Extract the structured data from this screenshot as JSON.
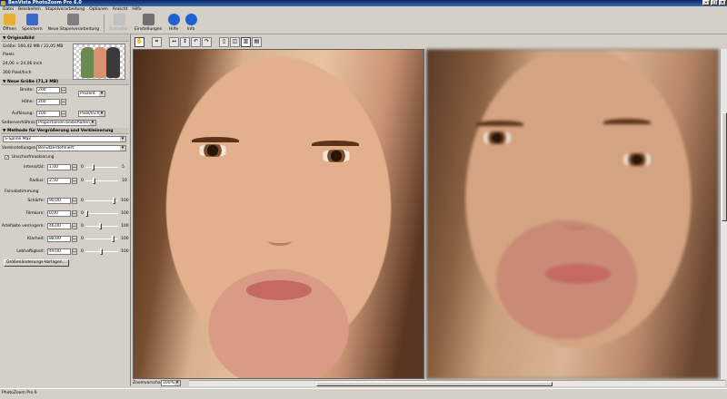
{
  "window": {
    "title": "BenVista PhotoZoom Pro 6.0"
  },
  "menu": [
    "Datei",
    "Bearbeiten",
    "Stapelverarbeitung",
    "Optionen",
    "Ansicht",
    "Hilfe"
  ],
  "toolbar": [
    {
      "label": "Öffnen",
      "icon": "open-folder-icon",
      "color": "#e8b030",
      "enabled": true
    },
    {
      "label": "Speichern",
      "icon": "save-disk-icon",
      "color": "#3a6ad0",
      "enabled": true
    },
    {
      "label": "Neue Stapelverarbeitung",
      "icon": "batch-icon",
      "color": "#808080",
      "enabled": true
    },
    {
      "label": "Schließen",
      "icon": "close-doc-icon",
      "color": "#a0a0a0",
      "enabled": false
    },
    {
      "label": "Einstellungen",
      "icon": "tools-icon",
      "color": "#707070",
      "enabled": true
    },
    {
      "label": "Hilfe",
      "icon": "help-icon",
      "color": "#2060d0",
      "enabled": true
    },
    {
      "label": "Info",
      "icon": "info-icon",
      "color": "#2060d0",
      "enabled": true
    }
  ],
  "original": {
    "section": "Originalbild",
    "size": "Größe: 160,42 MB / 22,05 MB",
    "pixels": "Pixels",
    "dims": "24,06 × 24,06 Inch",
    "dpi": "300 Pixel/Inch"
  },
  "newsize": {
    "section": "Neue Größe (71,3 MB)",
    "width_label": "Breite:",
    "width_value": "200",
    "height_label": "Höhe:",
    "height_value": "200",
    "res_label": "Auflösung:",
    "res_value": "100",
    "unit": "Prozent",
    "res_unit": "Pixel/Inch",
    "ratio_label": "Seitenverhältnis:",
    "ratio_value": "Proportionen beibehalten"
  },
  "method": {
    "section": "Methode für Vergrößerung und Verkleinerung",
    "algorithm": "S-Spline Max",
    "preset_label": "Voreinstellungen:",
    "preset_value": "Benutzerdefiniert",
    "unsharp_label": "Unscharfmaskierung",
    "intensity_label": "Intensität:",
    "intensity_value": "1,00",
    "intensity_min": "0",
    "intensity_max": "5",
    "intensity_level": 0.2,
    "radius_label": "Radius:",
    "radius_value": "2,50",
    "radius_min": "0",
    "radius_max": "10",
    "radius_level": 0.25,
    "fine_label": "Feinabstimmung",
    "sharp_label": "Schärfe:",
    "sharp_value": "90,00",
    "sharp_min": "0",
    "sharp_max": "100",
    "sharp_level": 0.9,
    "film_label": "Filmkorn:",
    "film_value": "0,00",
    "film_min": "0",
    "film_max": "100",
    "film_level": 0.0,
    "artifact_label": "Artefakte verringern:",
    "artifact_value": "46,00",
    "artifact_min": "0",
    "artifact_max": "100",
    "artifact_level": 0.46,
    "clarity_label": "Klarheit:",
    "clarity_value": "88,00",
    "clarity_min": "0",
    "clarity_max": "100",
    "clarity_level": 0.88,
    "vivid_label": "Lebhaftigkeit:",
    "vivid_value": "49,00",
    "vivid_min": "0",
    "vivid_max": "100",
    "vivid_level": 0.49,
    "presets_button": "Größenänderungs-Vorlagen..."
  },
  "view": {
    "zoom_label": "Zoomvorschau:",
    "zoom_value": "100%",
    "tools": [
      "hand-tool-icon",
      "crop-icon",
      "flip-horizontal-icon",
      "flip-vertical-icon",
      "rotate-left-icon",
      "rotate-right-icon",
      "single-view-icon",
      "split-vertical-icon",
      "split-dual-icon",
      "split-horizontal-icon"
    ]
  },
  "status": {
    "text": "PhotoZoom Pro 6"
  }
}
